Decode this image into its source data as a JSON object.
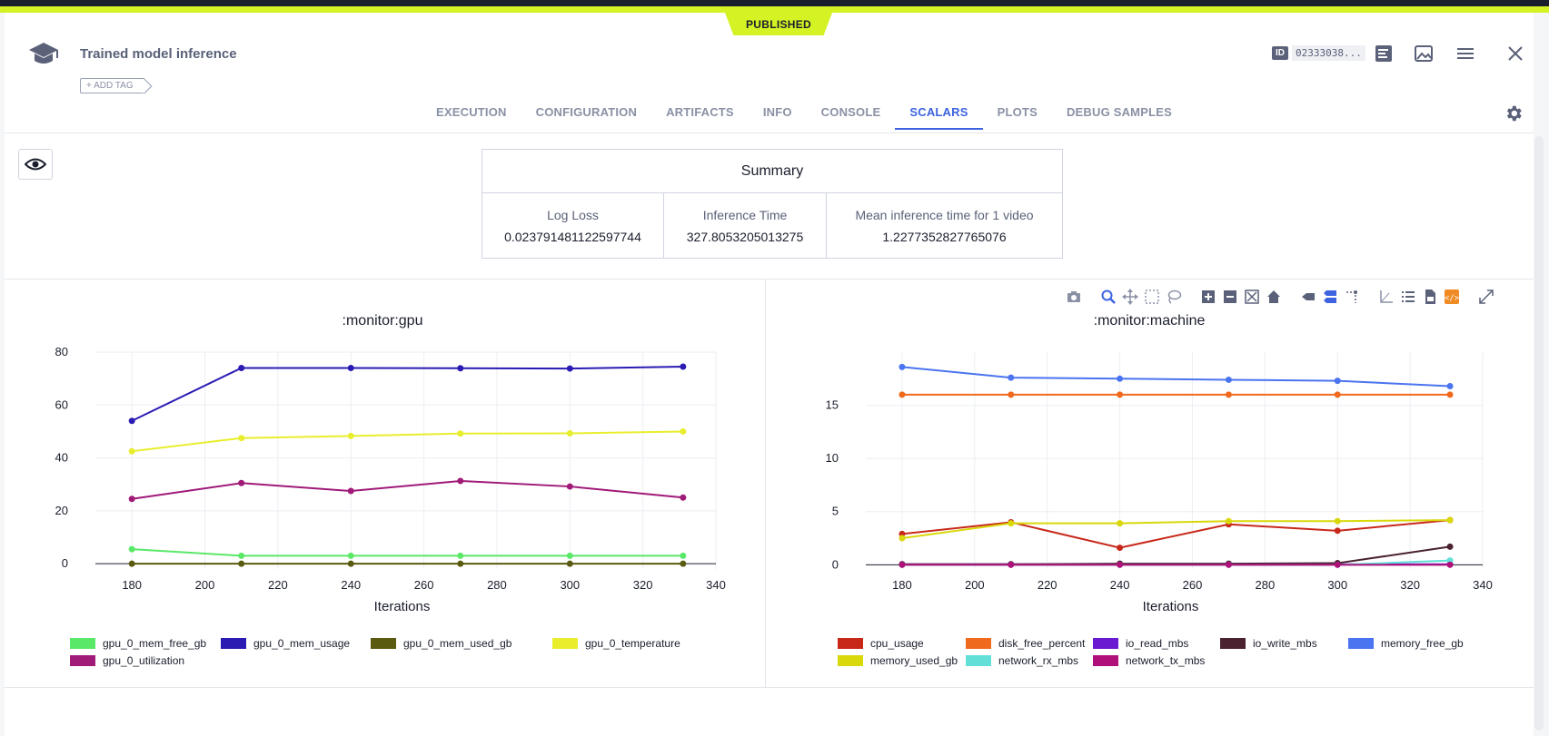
{
  "status_badge": "PUBLISHED",
  "task": {
    "title": "Trained model inference",
    "add_tag": "+ ADD TAG"
  },
  "header": {
    "id_label": "ID",
    "id_value": "02333038..."
  },
  "tabs": [
    "EXECUTION",
    "CONFIGURATION",
    "ARTIFACTS",
    "INFO",
    "CONSOLE",
    "SCALARS",
    "PLOTS",
    "DEBUG SAMPLES"
  ],
  "active_tab": "SCALARS",
  "summary": {
    "title": "Summary",
    "metrics": [
      {
        "label": "Log Loss",
        "value": "0.023791481122597744"
      },
      {
        "label": "Inference Time",
        "value": "327.8053205013275"
      },
      {
        "label": "Mean inference time for 1 video",
        "value": "1.2277352827765076"
      }
    ]
  },
  "colors": {
    "accent": "#3d63e0",
    "brand": "#d4f224"
  },
  "icons": [
    "graduation-cap-icon",
    "list-icon",
    "image-icon",
    "menu-icon",
    "close-icon",
    "gear-icon",
    "eye-icon",
    "camera-icon",
    "zoom-icon",
    "pan-icon",
    "box-select-icon",
    "lasso-icon",
    "zoom-in-icon",
    "zoom-out-icon",
    "autoscale-icon",
    "home-icon",
    "hover-closest-icon",
    "hover-compare-icon",
    "spike-icon",
    "axis-icon",
    "legend-icon",
    "csv-icon",
    "json-icon",
    "fullscreen-icon"
  ],
  "chart_data": [
    {
      "type": "line",
      "title": ":monitor:gpu",
      "xlabel": "Iterations",
      "ylabel": "",
      "xlim": [
        170,
        340
      ],
      "ylim": [
        -2,
        80
      ],
      "xticks": [
        180,
        200,
        220,
        240,
        260,
        280,
        300,
        320,
        340
      ],
      "yticks": [
        0,
        20,
        40,
        60,
        80
      ],
      "grid": true,
      "legend_placement": "bottom",
      "x": [
        180,
        210,
        240,
        270,
        300,
        331
      ],
      "series": [
        {
          "name": "gpu_0_mem_free_gb",
          "color": "#5ae868",
          "values": [
            5.5,
            3,
            3,
            3,
            3,
            3
          ]
        },
        {
          "name": "gpu_0_mem_usage",
          "color": "#2a1bb3",
          "values": [
            54,
            74,
            74,
            73.9,
            73.8,
            74.5
          ]
        },
        {
          "name": "gpu_0_mem_used_gb",
          "color": "#5a5a10",
          "values": [
            0,
            0,
            0,
            0,
            0,
            0
          ]
        },
        {
          "name": "gpu_0_temperature",
          "color": "#e8ee2c",
          "values": [
            42.5,
            47.5,
            48.3,
            49.2,
            49.3,
            50
          ]
        },
        {
          "name": "gpu_0_utilization",
          "color": "#a01a78",
          "values": [
            24.5,
            30.5,
            27.5,
            31.3,
            29.2,
            25
          ]
        }
      ]
    },
    {
      "type": "line",
      "title": ":monitor:machine",
      "xlabel": "Iterations",
      "ylabel": "",
      "xlim": [
        170,
        340
      ],
      "ylim": [
        -0.4,
        20
      ],
      "xticks": [
        180,
        200,
        220,
        240,
        260,
        280,
        300,
        320,
        340
      ],
      "yticks": [
        0,
        5,
        10,
        15
      ],
      "grid": true,
      "legend_placement": "bottom",
      "x": [
        180,
        210,
        240,
        270,
        300,
        331
      ],
      "series": [
        {
          "name": "cpu_usage",
          "color": "#c8281a",
          "values": [
            2.9,
            4.0,
            1.6,
            3.8,
            3.2,
            4.2
          ]
        },
        {
          "name": "disk_free_percent",
          "color": "#f06a1e",
          "values": [
            16.0,
            16.0,
            16.0,
            16.0,
            16.0,
            16.0
          ]
        },
        {
          "name": "io_read_mbs",
          "color": "#6a1ad0",
          "values": [
            0.05,
            0.05,
            0.05,
            0.05,
            0.05,
            0.05
          ]
        },
        {
          "name": "io_write_mbs",
          "color": "#4a2230",
          "values": [
            0.05,
            0.05,
            0.1,
            0.1,
            0.15,
            1.7
          ]
        },
        {
          "name": "memory_free_gb",
          "color": "#4a74f0",
          "values": [
            18.6,
            17.6,
            17.5,
            17.4,
            17.3,
            16.8
          ]
        },
        {
          "name": "memory_used_gb",
          "color": "#d8d80a",
          "values": [
            2.5,
            3.9,
            3.9,
            4.1,
            4.1,
            4.2
          ]
        },
        {
          "name": "network_rx_mbs",
          "color": "#62e0d8",
          "values": [
            0.0,
            0.0,
            0.0,
            0.0,
            0.0,
            0.4
          ]
        },
        {
          "name": "network_tx_mbs",
          "color": "#b0107a",
          "values": [
            0.0,
            0.0,
            0.0,
            0.0,
            0.0,
            0.0
          ]
        }
      ]
    }
  ]
}
